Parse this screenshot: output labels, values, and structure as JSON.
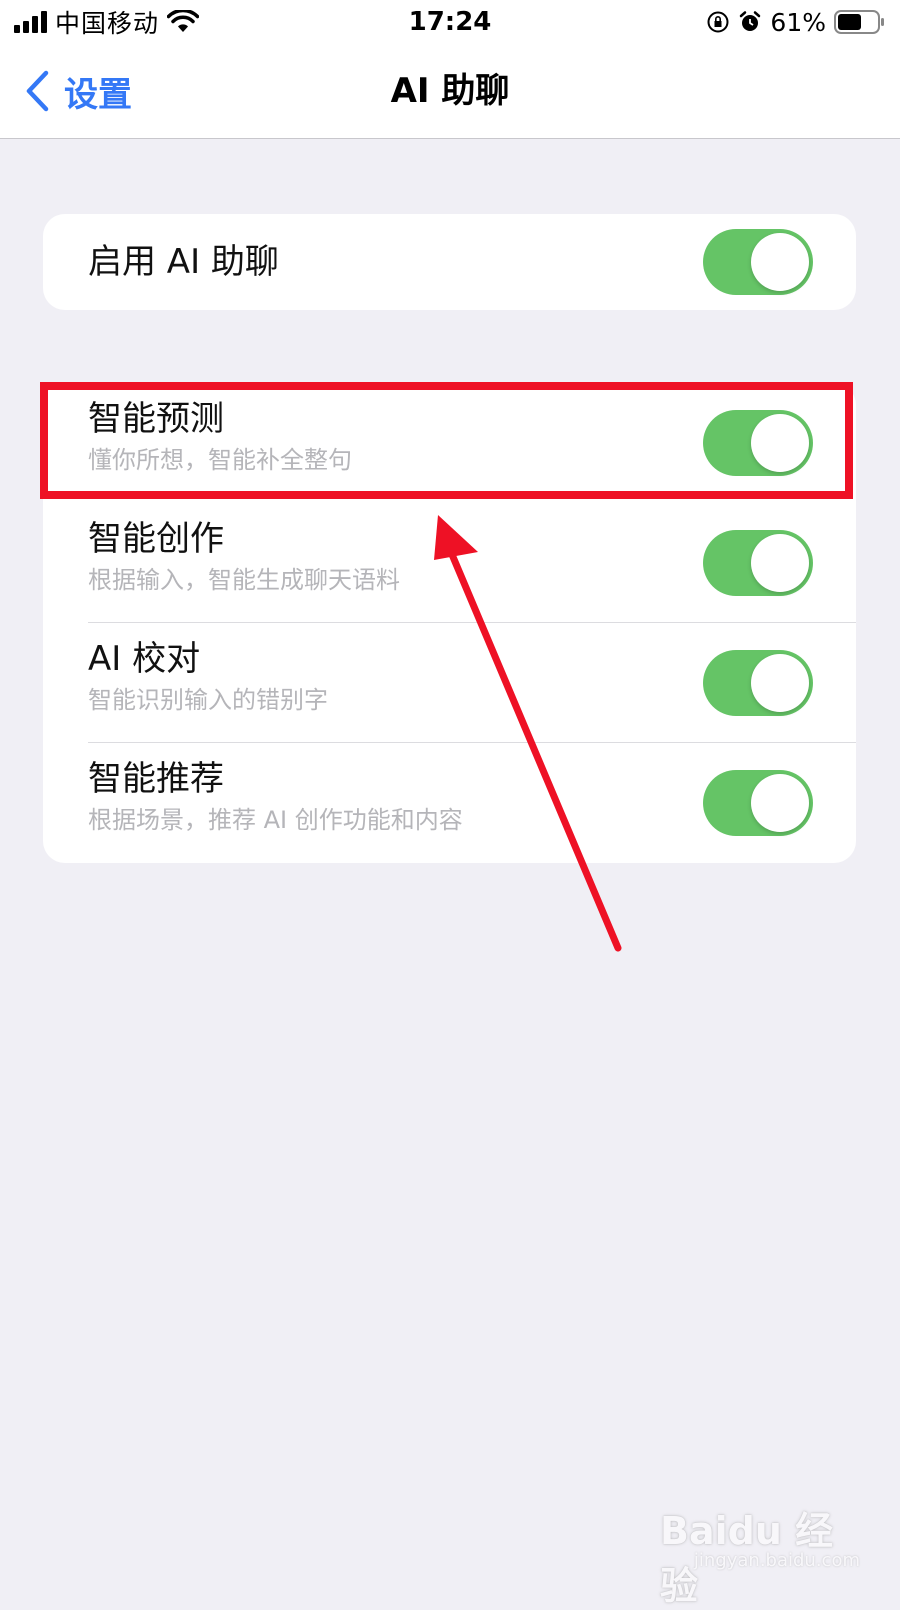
{
  "status_bar": {
    "carrier": "中国移动",
    "time": "17:24",
    "battery_percent": "61%",
    "battery_level": 0.61,
    "icons": [
      "signal-icon",
      "wifi-icon",
      "orientation-lock-icon",
      "alarm-icon",
      "battery-icon"
    ]
  },
  "nav": {
    "back_label": "设置",
    "title": "AI 助聊"
  },
  "main_toggle": {
    "title": "启用 AI 助聊",
    "enabled": true
  },
  "features": [
    {
      "title": "智能预测",
      "subtitle": "懂你所想，智能补全整句",
      "enabled": true
    },
    {
      "title": "智能创作",
      "subtitle": "根据输入，智能生成聊天语料",
      "enabled": true
    },
    {
      "title": "AI 校对",
      "subtitle": "智能识别输入的错别字",
      "enabled": true
    },
    {
      "title": "智能推荐",
      "subtitle": "根据场景，推荐 AI 创作功能和内容",
      "enabled": true
    }
  ],
  "watermark": {
    "brand": "Baidu 经验",
    "url": "jingyan.baidu.com"
  },
  "colors": {
    "accent": "#3478f6",
    "toggle_on": "#65c466",
    "annotation": "#ee1125",
    "background": "#f0eff5"
  }
}
